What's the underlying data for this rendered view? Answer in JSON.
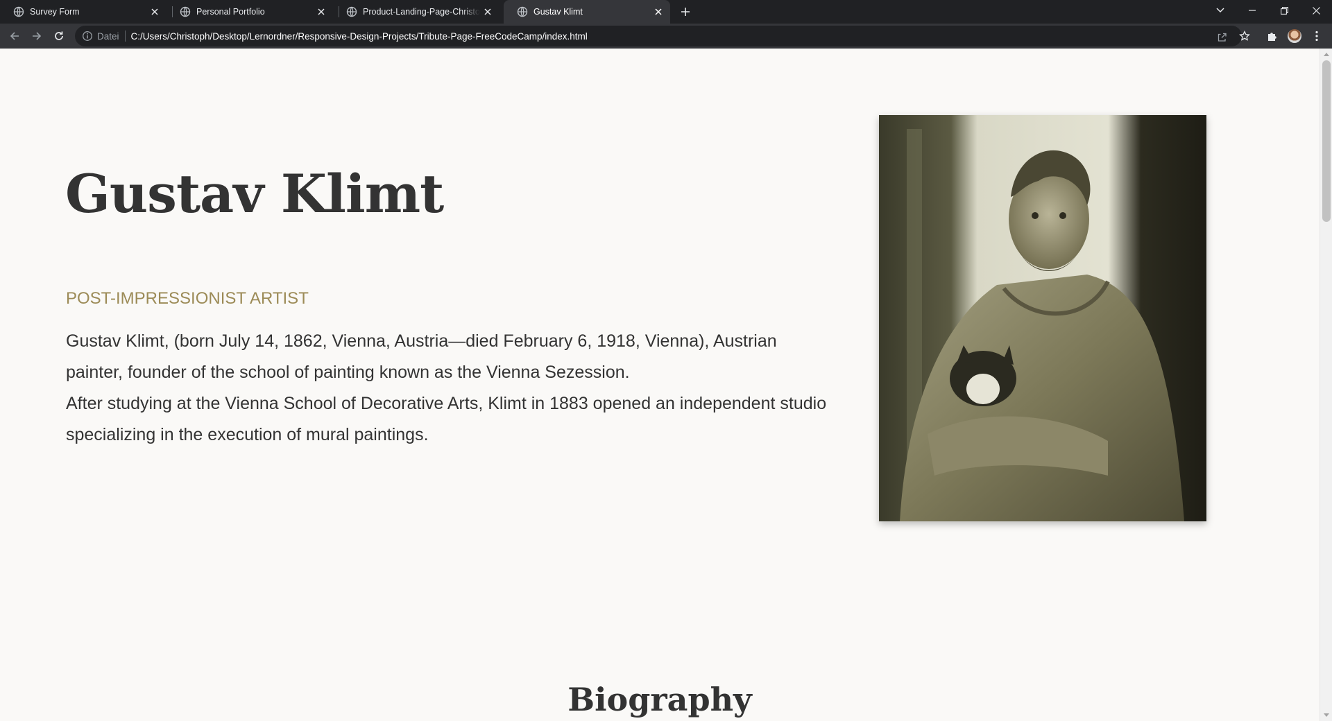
{
  "browser": {
    "tabs": [
      {
        "title": "Survey Form",
        "active": false
      },
      {
        "title": "Personal Portfolio",
        "active": false
      },
      {
        "title": "Product-Landing-Page-Christoph",
        "active": false
      },
      {
        "title": "Gustav Klimt",
        "active": true
      }
    ],
    "address": {
      "scheme_label": "Datei",
      "url": "C:/Users/Christoph/Desktop/Lernordner/Responsive-Design-Projects/Tribute-Page-FreeCodeCamp/index.html"
    }
  },
  "page": {
    "title": "Gustav Klimt",
    "subtitle": "POST-IMPRESSIONIST ARTIST",
    "intro_line1": "Gustav Klimt, (born July 14, 1862, Vienna, Austria—died February 6, 1918, Vienna), Austrian painter, founder of the school of painting known as the Vienna Sezession.",
    "intro_line2": "After studying at the Vienna School of Decorative Arts, Klimt in 1883 opened an independent studio specializing in the execution of mural paintings.",
    "section_heading": "Biography"
  },
  "colors": {
    "tabstrip_bg": "#202124",
    "toolbar_bg": "#35363a",
    "page_bg": "#faf9f7",
    "heading": "#333333",
    "subtitle_accent": "#9c8b57"
  }
}
